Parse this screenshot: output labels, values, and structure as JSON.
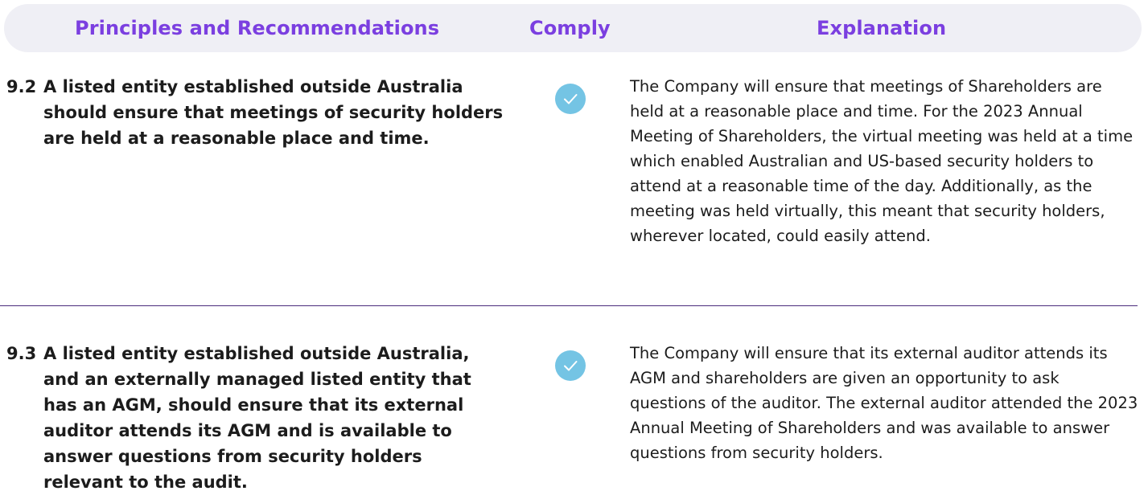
{
  "header": {
    "principles_label": "Principles and Recommendations",
    "comply_label": "Comply",
    "explanation_label": "Explanation"
  },
  "colors": {
    "accent": "#7b3fe0",
    "header_bg": "#efeff5",
    "check_fill": "#74c4e4",
    "divider": "#4a2c7c",
    "body_text": "#1c1c1c"
  },
  "rows": [
    {
      "number": "9.2",
      "principle": "A listed entity established outside Australia should ensure that meetings of security holders are held at a reasonable place and time.",
      "comply_icon": "check-circle-icon",
      "explanation": "The Company will ensure that meetings of Shareholders are held at a reasonable place and time. For the 2023 Annual Meeting of Shareholders, the virtual meeting was held at a time which enabled Australian and US-based security holders to attend at a reasonable time of the day. Additionally, as the meeting was held virtually, this meant that security holders, wherever located, could easily attend."
    },
    {
      "number": "9.3",
      "principle": "A listed entity established outside Australia, and an externally managed listed entity that has an AGM, should ensure that its external auditor attends its AGM and is available to answer questions from security holders relevant to the audit.",
      "comply_icon": "check-circle-icon",
      "explanation": "The Company will ensure that its external auditor attends its AGM and shareholders are given an opportunity to ask questions of the auditor.  The external auditor attended the 2023 Annual Meeting of Shareholders and was available to answer questions from security holders."
    }
  ]
}
